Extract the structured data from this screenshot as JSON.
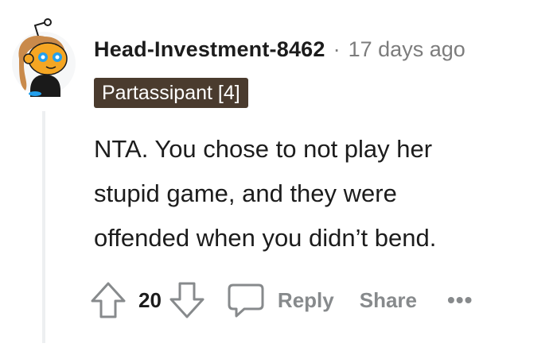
{
  "comment": {
    "username": "Head-Investment-8462",
    "separator": "·",
    "timestamp": "17 days ago",
    "flair": "Partassipant [4]",
    "body_lines": [
      "NTA. You chose to not play her",
      "stupid game, and they were",
      "offended when you didn’t bend."
    ],
    "votes": "20",
    "reply_label": "Reply",
    "share_label": "Share",
    "more_label": "•••"
  },
  "icons": {
    "avatar": "snoo-avatar-icon",
    "upvote": "upvote-arrow-icon",
    "downvote": "downvote-arrow-icon",
    "reply": "speech-bubble-icon"
  },
  "colors": {
    "flair_background": "#4a3b2e",
    "muted_text": "#878a8c",
    "thread_line": "#edeff1",
    "avatar_skin": "#f5a623",
    "avatar_eye": "#24a0ed"
  }
}
